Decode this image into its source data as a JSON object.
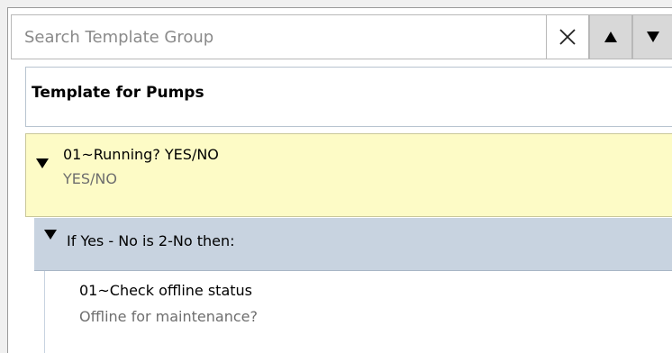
{
  "search": {
    "placeholder": "Search Template Group",
    "value": ""
  },
  "icons": {
    "clear": "close-icon",
    "up": "arrow-up-icon",
    "down": "arrow-down-icon",
    "expand": "triangle-down-icon"
  },
  "template": {
    "title": "Template for Pumps"
  },
  "question": {
    "label": "01~Running? YES/NO",
    "answer_type": "YES/NO",
    "background": "#fdfbc6"
  },
  "condition": {
    "label": "If Yes - No is 2-No then:",
    "background": "#c8d3e0"
  },
  "child": {
    "label": "01~Check offline status",
    "description": "Offline for maintenance?"
  }
}
